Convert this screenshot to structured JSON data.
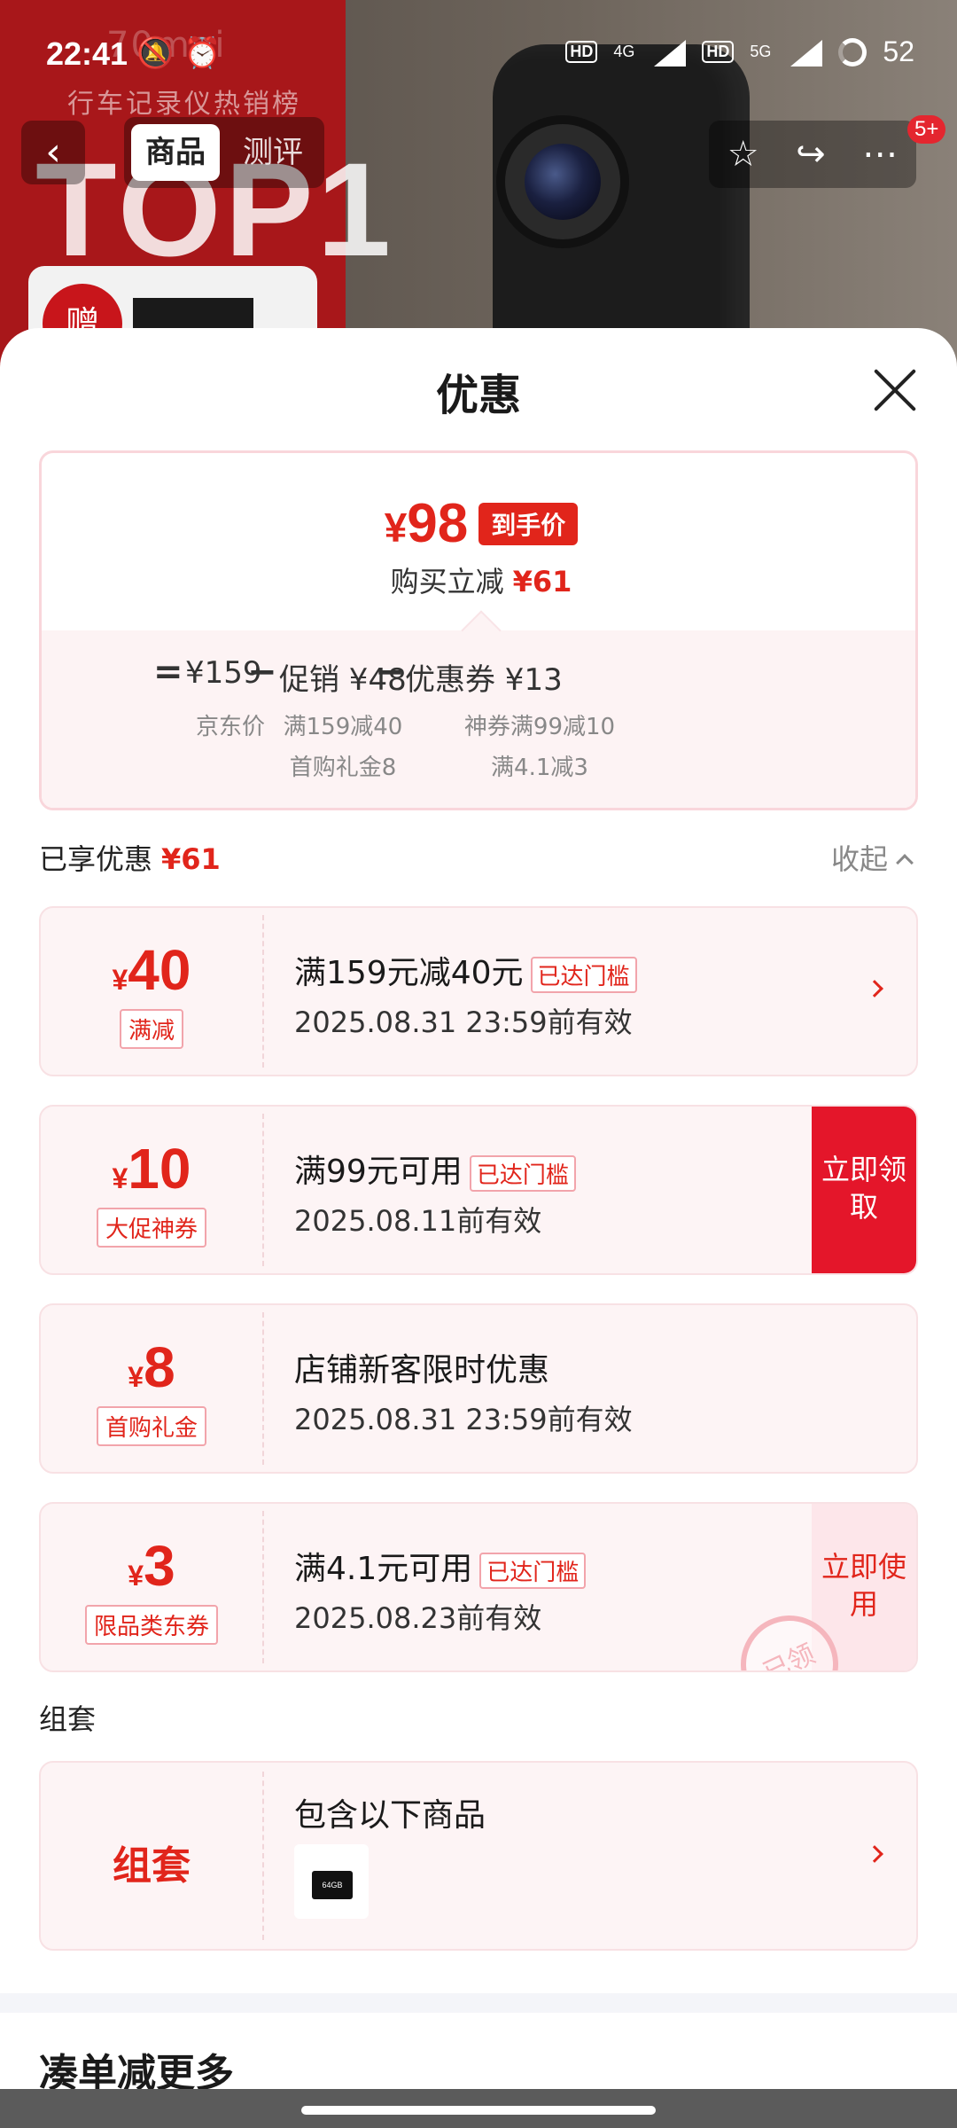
{
  "status_bar": {
    "time": "22:41",
    "network1": "4G",
    "network2": "5G",
    "battery": "52"
  },
  "background": {
    "brand": "70mai",
    "subtitle": "行车记录仪热销榜",
    "top_rank": "TOP1",
    "gift": "赠"
  },
  "nav": {
    "back_icon": "chevron-left-icon",
    "tabs": [
      {
        "label": "商品",
        "active": true
      },
      {
        "label": "测评",
        "active": false
      }
    ],
    "badge": "5+"
  },
  "sheet": {
    "title": "优惠",
    "price": {
      "currency": "¥",
      "final_price": "98",
      "final_label": "到手价",
      "reduce_label": "购买立减",
      "reduce_amount": "¥61",
      "eq": "=",
      "minus": "−",
      "jd_price": "¥159",
      "jd_price_label": "京东价",
      "promo": "促销 ¥48",
      "promo_detail_1": "满159减40",
      "promo_detail_2": "首购礼金8",
      "coupon": "优惠券 ¥13",
      "coupon_detail_1": "神券满99减10",
      "coupon_detail_2": "满4.1减3"
    },
    "enjoyed": {
      "label": "已享优惠",
      "amount": "¥61",
      "collapse": "收起"
    },
    "coupons": [
      {
        "currency": "¥",
        "amount": "40",
        "tag": "满减",
        "title": "满159元减40元",
        "badge": "已达门槛",
        "validity": "2025.08.31 23:59前有效",
        "action": "arrow"
      },
      {
        "currency": "¥",
        "amount": "10",
        "tag": "大促神券",
        "title": "满99元可用",
        "badge": "已达门槛",
        "validity": "2025.08.11前有效",
        "action": "立即领取"
      },
      {
        "currency": "¥",
        "amount": "8",
        "tag": "首购礼金",
        "title": "店铺新客限时优惠",
        "badge": "",
        "validity": "2025.08.31 23:59前有效",
        "action": ""
      },
      {
        "currency": "¥",
        "amount": "3",
        "tag": "限品类东券",
        "title": "满4.1元可用",
        "badge": "已达门槛",
        "validity": "2025.08.23前有效",
        "action": "立即使用",
        "stamp": "已领"
      }
    ],
    "bundle": {
      "section_label": "组套",
      "left_label": "组套",
      "title": "包含以下商品",
      "thumb_text": "64GB"
    },
    "more_title": "凑单减更多"
  },
  "colors": {
    "accent": "#e1251b",
    "coupon_bg": "#fdf4f5",
    "action_red": "#e4162a"
  }
}
